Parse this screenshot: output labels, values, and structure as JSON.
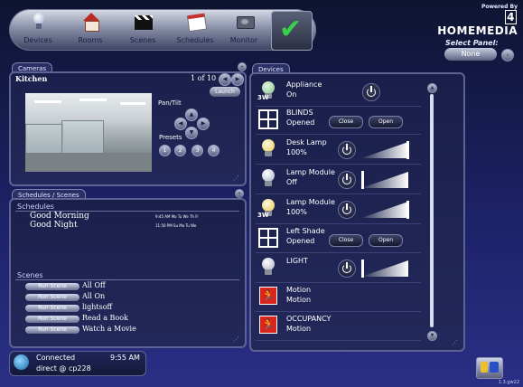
{
  "brand": {
    "powered_by": "Powered By",
    "logo_number": "4",
    "logo_text": "HOMEMEDIA"
  },
  "nav": {
    "items": [
      {
        "label": "Devices",
        "icon": "lightbulb-icon"
      },
      {
        "label": "Rooms",
        "icon": "house-icon"
      },
      {
        "label": "Scenes",
        "icon": "clapperboard-icon"
      },
      {
        "label": "Schedules",
        "icon": "calendar-icon"
      },
      {
        "label": "Monitor",
        "icon": "monitor-icon"
      }
    ],
    "done_icon": "checkmark-icon"
  },
  "select_panel": {
    "label": "Select Panel:",
    "value": "None"
  },
  "cameras": {
    "tab": "Cameras",
    "camera_name": "Kitchen",
    "counter": "1 of 10",
    "launch_label": "Launch",
    "pan_tilt_label": "Pan/Tilt",
    "presets_label": "Presets",
    "presets": [
      "1",
      "2",
      "3",
      "4"
    ]
  },
  "schedules": {
    "tab": "Schedules / Scenes",
    "schedules_header": "Schedules",
    "items": [
      {
        "name": "Good Morning",
        "time": "9:45 AM Mo Tu We Th Fr"
      },
      {
        "name": "Good Night",
        "time": "11:50 PM Su Mo Tu We"
      }
    ],
    "scenes_header": "Scenes",
    "run_label": "Run Scene",
    "scenes": [
      "All Off",
      "All On",
      "lightsoff",
      "Read a Book",
      "Watch a Movie"
    ]
  },
  "devices": {
    "tab": "Devices",
    "items": [
      {
        "name": "Appliance",
        "status": "On",
        "kind": "appliance",
        "icon": "appliance-bulb-icon"
      },
      {
        "name": "BLINDS",
        "status": "Opened",
        "kind": "blinds",
        "icon": "blinds-icon",
        "close": "Close",
        "open": "Open"
      },
      {
        "name": "Desk Lamp",
        "status": "100%",
        "kind": "dimmer",
        "icon": "bulb-on-icon",
        "level": 1.0
      },
      {
        "name": "Lamp Module",
        "status": "Off",
        "kind": "dimmer",
        "icon": "bulb-off-icon",
        "level": 0.0
      },
      {
        "name": "Lamp Module",
        "status": "100%",
        "kind": "dimmer",
        "icon": "bulb-on-icon",
        "level": 1.0
      },
      {
        "name": "Left Shade",
        "status": "Opened",
        "kind": "blinds",
        "icon": "blinds-icon",
        "close": "Close",
        "open": "Open"
      },
      {
        "name": "LIGHT",
        "status": "",
        "kind": "dimmer",
        "icon": "bulb-off-icon",
        "level": 0.0
      },
      {
        "name": "Motion",
        "status": "Motion",
        "kind": "motion",
        "icon": "motion-sensor-icon"
      },
      {
        "name": "OCCUPANCY",
        "status": "Motion",
        "kind": "motion",
        "icon": "motion-sensor-icon"
      }
    ]
  },
  "status": {
    "connection": "Connected",
    "time": "9:55 AM",
    "user": "direct @ cp228"
  },
  "version": "1.3.gw22"
}
